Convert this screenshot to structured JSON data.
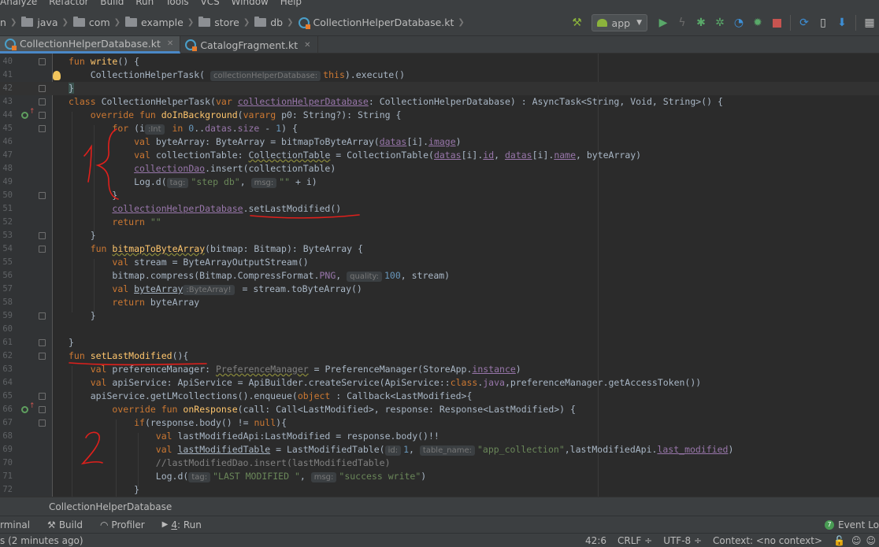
{
  "menu": [
    "Analyze",
    "Refactor",
    "Build",
    "Run",
    "Tools",
    "VCS",
    "Window",
    "Help"
  ],
  "breadcrumbs": [
    "n",
    "java",
    "com",
    "example",
    "store",
    "db",
    "CollectionHelperDatabase.kt"
  ],
  "run_config": "app",
  "tabs": [
    {
      "label": "CollectionHelperDatabase.kt",
      "active": true
    },
    {
      "label": "CatalogFragment.kt",
      "active": false
    }
  ],
  "lines": [
    {
      "n": "40"
    },
    {
      "n": "41"
    },
    {
      "n": "42"
    },
    {
      "n": "43"
    },
    {
      "n": "44"
    },
    {
      "n": "45"
    },
    {
      "n": "46"
    },
    {
      "n": "47"
    },
    {
      "n": "48"
    },
    {
      "n": "49"
    },
    {
      "n": "50"
    },
    {
      "n": "51"
    },
    {
      "n": "52"
    },
    {
      "n": "53"
    },
    {
      "n": "54"
    },
    {
      "n": "55"
    },
    {
      "n": "56"
    },
    {
      "n": "57"
    },
    {
      "n": "58"
    },
    {
      "n": "59"
    },
    {
      "n": "60"
    },
    {
      "n": "61"
    },
    {
      "n": "62"
    },
    {
      "n": "63"
    },
    {
      "n": "64"
    },
    {
      "n": "65"
    },
    {
      "n": "66"
    },
    {
      "n": "67"
    },
    {
      "n": "68"
    },
    {
      "n": "69"
    },
    {
      "n": "70"
    },
    {
      "n": "71"
    },
    {
      "n": "72"
    }
  ],
  "code": {
    "l40": [
      "fun",
      "write",
      "() {"
    ],
    "l41": [
      "CollectionHelperTask(",
      "collectionHelperDatabase:",
      "this",
      ").execute()"
    ],
    "l42": [
      "}"
    ],
    "l43": [
      "class",
      "CollectionHelperTask(",
      "var",
      "collectionHelperDatabase",
      ": CollectionHelperDatabase) : AsyncTask<String, Void, String>() {"
    ],
    "l44": [
      "override fun",
      "doInBackground",
      "(",
      "vararg",
      " p0: String?): String {"
    ],
    "l45": [
      "for",
      "(i",
      ":Int",
      "in",
      "0",
      "..",
      "datas",
      ".",
      "size",
      "-",
      "1",
      ") {"
    ],
    "l46": [
      "val",
      "byteArray: ByteArray = bitmapToByteArray(",
      "datas",
      "[i].",
      "image",
      ")"
    ],
    "l47": [
      "val",
      "collectionTable: ",
      "CollectionTable",
      " = CollectionTable(",
      "datas",
      "[i].",
      "id",
      ", ",
      "datas",
      "[i].",
      "name",
      ", byteArray)"
    ],
    "l48": [
      "collectionDao",
      ".insert(collectionTable)"
    ],
    "l49": [
      "Log.d(",
      "tag:",
      "\"step db\"",
      ", ",
      "msg:",
      "\"\"",
      " + i)"
    ],
    "l50": [
      "}"
    ],
    "l51": [
      "collectionHelperDatabase",
      ".setLastModified()"
    ],
    "l52": [
      "return",
      "\"\""
    ],
    "l53": [
      "}"
    ],
    "l54": [
      "fun",
      "bitmapToByteArray",
      "(bitmap: Bitmap): ByteArray {"
    ],
    "l55": [
      "val",
      "stream = ByteArrayOutputStream()"
    ],
    "l56": [
      "bitmap.compress(Bitmap.CompressFormat.",
      "PNG",
      ", ",
      "quality:",
      "100",
      ", stream)"
    ],
    "l57": [
      "val",
      "byteArray",
      ":ByteArray!",
      " = stream.toByteArray()"
    ],
    "l58": [
      "return",
      "byteArray"
    ],
    "l59": [
      "}"
    ],
    "l61": [
      "}"
    ],
    "l62": [
      "fun",
      "setLastModified",
      "(){"
    ],
    "l63": [
      "val",
      "preferenceManager: ",
      "PreferenceManager",
      " = PreferenceManager(StoreApp.",
      "instance",
      ")"
    ],
    "l64": [
      "val",
      "apiService: ApiService = ApiBuilder.createService(ApiService::",
      "class",
      ".",
      "java",
      ",preferenceManager.getAccessToken())"
    ],
    "l65": [
      "apiService.getLMcollections().enqueue(",
      "object",
      " : Callback<LastModified>{"
    ],
    "l66": [
      "override fun",
      "onResponse",
      "(call: Call<LastModified>, response: Response<LastModified>) {"
    ],
    "l67": [
      "if",
      "(response.body() != ",
      "null",
      "){"
    ],
    "l68": [
      "val",
      "lastModifiedApi:LastModified = response.body()!!"
    ],
    "l69": [
      "val",
      "lastModifiedTable",
      " = LastModifiedTable(",
      "id:",
      "1",
      ", ",
      "table_name:",
      "\"app_collection\"",
      ",lastModifiedApi.",
      "last_modified",
      ")"
    ],
    "l70": [
      "//lastModifiedDao.insert(lastModifiedTable)"
    ],
    "l71": [
      "Log.d(",
      "tag:",
      "\"LAST MODIFIED \"",
      ", ",
      "msg:",
      "\"success write\"",
      ")"
    ],
    "l72": [
      "}"
    ]
  },
  "annotations": {
    "label1": "1",
    "label2": "2",
    "color": "#e0201c"
  },
  "breadcrumb_bar": "CollectionHelperDatabase",
  "tool_windows": [
    "rminal",
    "Build",
    "Profiler",
    "4",
    ": Run"
  ],
  "event_log": {
    "count": "7",
    "label": "Event Lo"
  },
  "status": {
    "message": "s (2 minutes ago)",
    "position": "42:6",
    "line_sep": "CRLF ÷",
    "encoding": "UTF-8 ÷",
    "context": "Context: <no context>"
  }
}
